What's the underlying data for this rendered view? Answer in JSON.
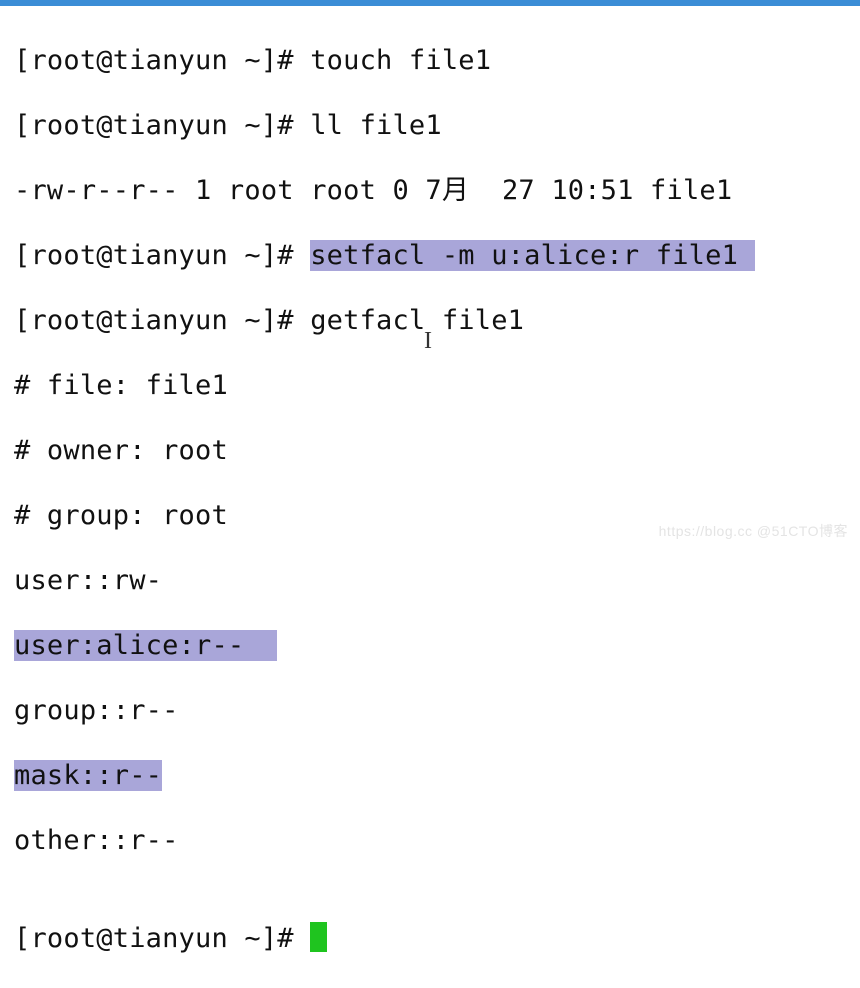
{
  "prompt": "[root@tianyun ~]# ",
  "lines": {
    "cmd1": "touch file1",
    "cmd2": "ll file1",
    "ll_out": "-rw-r--r-- 1 root root 0 7月  27 10:51 file1",
    "cmd3_pre": "",
    "cmd3_hl": "setfacl -m u:alice:r file1 ",
    "cmd4": "getfacl file1",
    "gf_file": "# file: file1",
    "gf_owner": "# owner: root",
    "gf_group": "# group: root",
    "gf_user": "user::rw-",
    "gf_alice": "user:alice:r--  ",
    "gf_groupp": "group::r--",
    "gf_mask": "mask::r--",
    "gf_other": "other::r--",
    "blank": "",
    "final_prompt": "[root@tianyun ~]# "
  },
  "ibeam": "I",
  "watermark": "https://blog.cc @51CTO博客"
}
